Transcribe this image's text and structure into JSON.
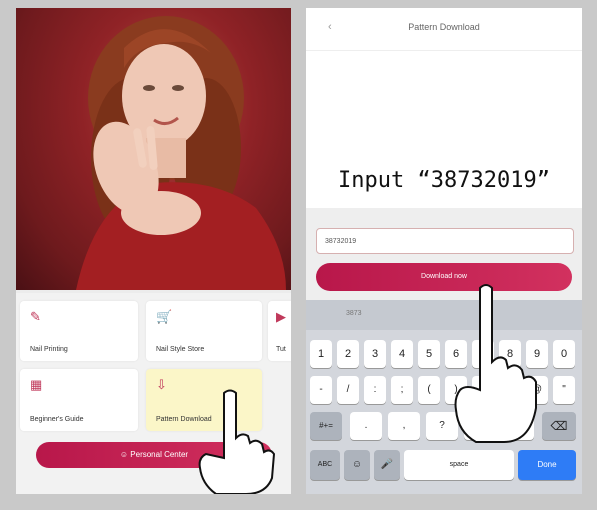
{
  "left_screen": {
    "tiles": [
      {
        "label": "Nail Printing",
        "icon": "pen-icon"
      },
      {
        "label": "Nail Style Store",
        "icon": "cart-icon"
      },
      {
        "label": "Tut",
        "icon": "play-icon"
      },
      {
        "label": "Beginner's Guide",
        "icon": "grid-icon"
      },
      {
        "label": "Pattern Download",
        "icon": "download-icon"
      }
    ],
    "personal_center_label": "Personal Center"
  },
  "right_screen": {
    "title": "Pattern Download",
    "back_glyph": "‹",
    "caption": "Input  “38732019”",
    "input_value": "38732019",
    "download_label": "Download now",
    "suggestion": "3873",
    "keys_row1": [
      "1",
      "2",
      "3",
      "4",
      "5",
      "6",
      "7",
      "8",
      "9",
      "0"
    ],
    "keys_row2": [
      "-",
      "/",
      ":",
      ";",
      "(",
      ")",
      "$",
      "&",
      "@",
      "\""
    ],
    "keys_row3": [
      "#+=",
      ".",
      ",",
      "?",
      "!",
      "'",
      "⌫"
    ],
    "keys_row4": [
      "ABC",
      "☺",
      "🎤",
      "space",
      "Done"
    ]
  },
  "colors": {
    "accent": "#c8264f",
    "done_key": "#2e7cf6"
  }
}
